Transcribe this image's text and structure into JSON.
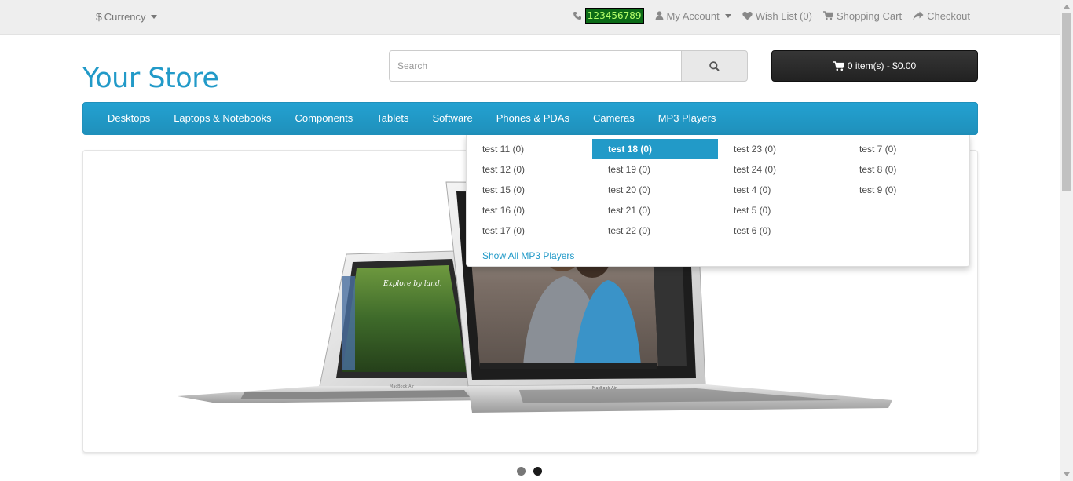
{
  "topbar": {
    "currency_symbol": "$",
    "currency_label": "Currency",
    "phone": "123456789",
    "my_account": "My Account",
    "wish_list": "Wish List (0)",
    "shopping_cart": "Shopping Cart",
    "checkout": "Checkout"
  },
  "header": {
    "logo": "Your Store",
    "search_placeholder": "Search",
    "cart_label": "0 item(s) - $0.00"
  },
  "menu": {
    "items": [
      "Desktops",
      "Laptops & Notebooks",
      "Components",
      "Tablets",
      "Software",
      "Phones & PDAs",
      "Cameras",
      "MP3 Players"
    ]
  },
  "dropdown": {
    "columns": [
      [
        "test 11 (0)",
        "test 12 (0)",
        "test 15 (0)",
        "test 16 (0)",
        "test 17 (0)"
      ],
      [
        "test 18 (0)",
        "test 19 (0)",
        "test 20 (0)",
        "test 21 (0)",
        "test 22 (0)"
      ],
      [
        "test 23 (0)",
        "test 24 (0)",
        "test 4 (0)",
        "test 5 (0)",
        "test 6 (0)"
      ],
      [
        "test 7 (0)",
        "test 8 (0)",
        "test 9 (0)"
      ]
    ],
    "active_item": "test 18 (0)",
    "show_all": "Show All MP3 Players"
  },
  "slideshow": {
    "screen_caption": "Explore by land.",
    "brand_left": "MacBook Air",
    "brand_right": "MacBook Air",
    "active_dot": 1,
    "dot_count": 2
  },
  "colors": {
    "accent": "#229ac8",
    "topbar": "#eeeeee",
    "cart_button": "#2a2a2a",
    "phone_bg": "#0c6b17",
    "phone_text": "#b5ff6a"
  }
}
